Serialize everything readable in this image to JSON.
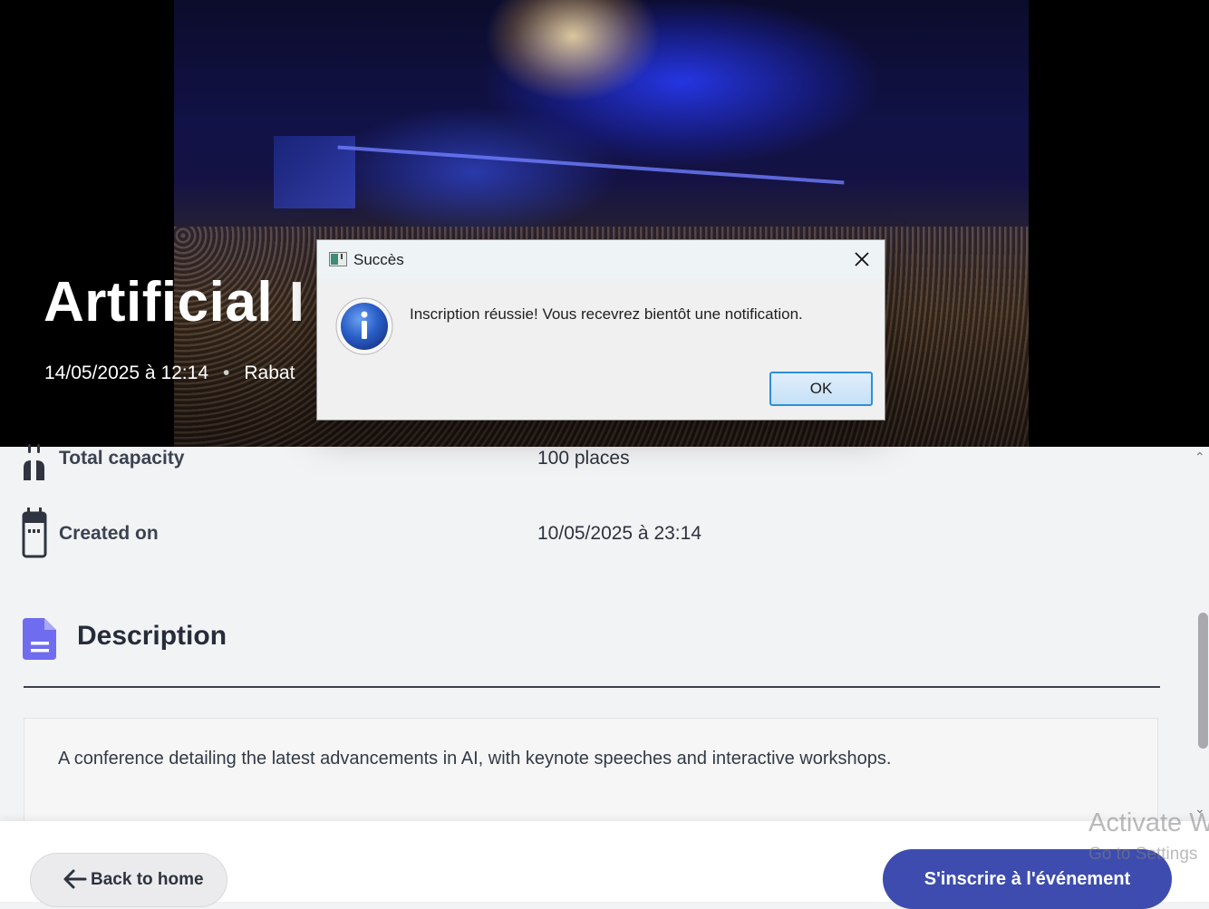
{
  "event": {
    "title": "Artificial I",
    "datetime": "14/05/2025 à 12:14",
    "location": "Rabat",
    "separator": "•"
  },
  "details": {
    "capacity_label": "Total capacity",
    "capacity_value": "100 places",
    "created_label": "Created on",
    "created_value": "10/05/2025 à 23:14"
  },
  "description": {
    "heading": "Description",
    "text": "A conference detailing the latest advancements in AI, with keynote speeches and interactive workshops."
  },
  "footer": {
    "back_label": "Back to home",
    "register_label": "S'inscrire à l'événement"
  },
  "dialog": {
    "title": "Succès",
    "message": "Inscription réussie! Vous recevrez bientôt une notification.",
    "ok_label": "OK"
  },
  "watermark": {
    "line1": "Activate W",
    "line2": "Go to Settings"
  },
  "colors": {
    "primary": "#3d4cae",
    "description_icon": "#6f6cf0",
    "background": "#f2f3f5"
  },
  "icons": [
    "people-icon",
    "calendar-icon",
    "document-icon",
    "arrow-left-icon",
    "info-icon",
    "close-icon",
    "app-window-icon"
  ]
}
